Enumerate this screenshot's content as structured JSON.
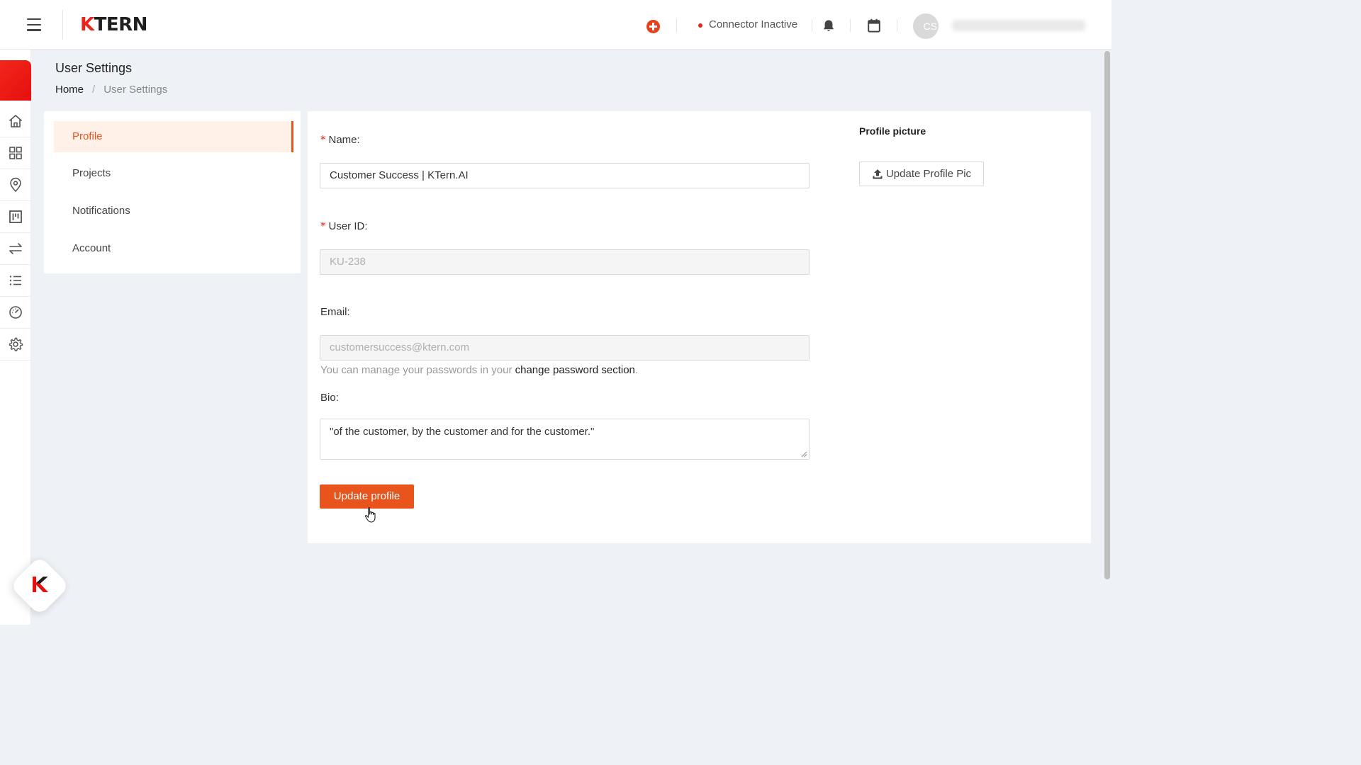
{
  "header": {
    "logo": "KTERN",
    "connector_status": "Connector Inactive",
    "avatar_initials": "CS"
  },
  "page": {
    "title": "User Settings",
    "breadcrumb": [
      "Home",
      "User Settings"
    ]
  },
  "settings_menu": {
    "items": [
      {
        "label": "Profile",
        "active": true
      },
      {
        "label": "Projects",
        "active": false
      },
      {
        "label": "Notifications",
        "active": false
      },
      {
        "label": "Account",
        "active": false
      }
    ]
  },
  "profile_form": {
    "name_label": "Name",
    "name_value": "Customer Success | KTern.AI",
    "user_id_label": "User ID",
    "user_id_value": "KU-238",
    "email_label": "Email",
    "email_value": "customersuccess@ktern.com",
    "hint_prefix": "You can manage your passwords in your ",
    "hint_link": "change password section",
    "hint_suffix": ".",
    "bio_label": "Bio",
    "bio_value": "\"of the customer, by the customer and for the customer.\"",
    "submit_label": "Update profile",
    "profile_picture_label": "Profile picture",
    "update_pic_label": "Update Profile Pic"
  },
  "colors": {
    "accent": "#e8541c",
    "brand_red": "#e8241c",
    "active_bg": "#fff1e8"
  },
  "icons": [
    "menu-icon",
    "plus-circle-icon",
    "bell-icon",
    "calendar-icon",
    "home-icon",
    "grid-icon",
    "location-pin-icon",
    "board-icon",
    "transfer-icon",
    "list-icon",
    "dashboard-gauge-icon",
    "gear-icon",
    "upload-icon"
  ]
}
